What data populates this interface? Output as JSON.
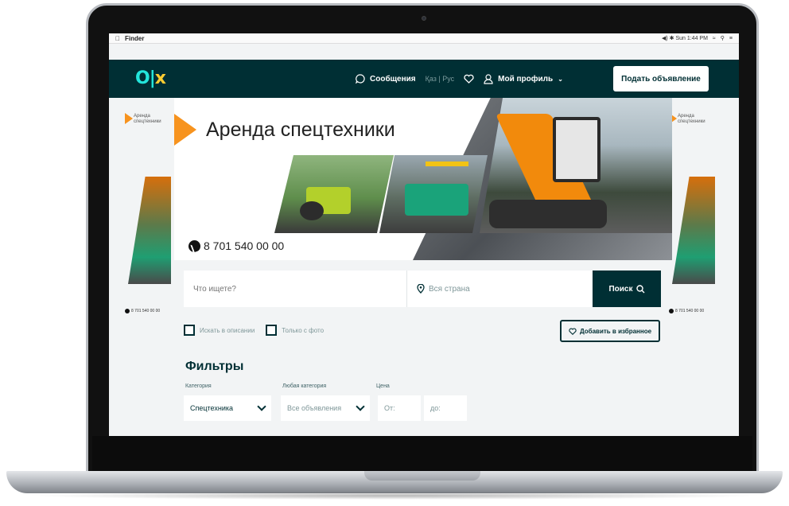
{
  "menubar": {
    "apple": "",
    "app": "Finder",
    "status": "◀) ✱ Sun 1:44 PM"
  },
  "header": {
    "logo_main": "O|",
    "logo_x": "x",
    "messages": "Сообщения",
    "lang": "Қаз | Рус",
    "profile": "Мой профиль",
    "post_ad": "Подать объявление"
  },
  "banner": {
    "title": "Аренда спецтехники",
    "phone": "8 701 540 00 00"
  },
  "side_ad": {
    "text": "Аренда спецтехники",
    "phone": "8 701 540 00 00"
  },
  "search": {
    "placeholder": "Что ищете?",
    "location": "Вся страна",
    "button": "Поиск"
  },
  "options": {
    "in_description": "Искать в описании",
    "photo_only": "Только с фото",
    "add_favorite": "Добавить в избранное"
  },
  "filters": {
    "title": "Фильтры",
    "category_label": "Категория",
    "any_category_label": "Любая категория",
    "price_label": "Цена",
    "category_value": "Спецтехника",
    "subcategory_value": "Все объявления",
    "price_from": "От:",
    "price_to": "до:"
  },
  "colors": {
    "header_bg": "#002f34",
    "accent_orange": "#f7931e",
    "logo_teal": "#23e5db"
  }
}
